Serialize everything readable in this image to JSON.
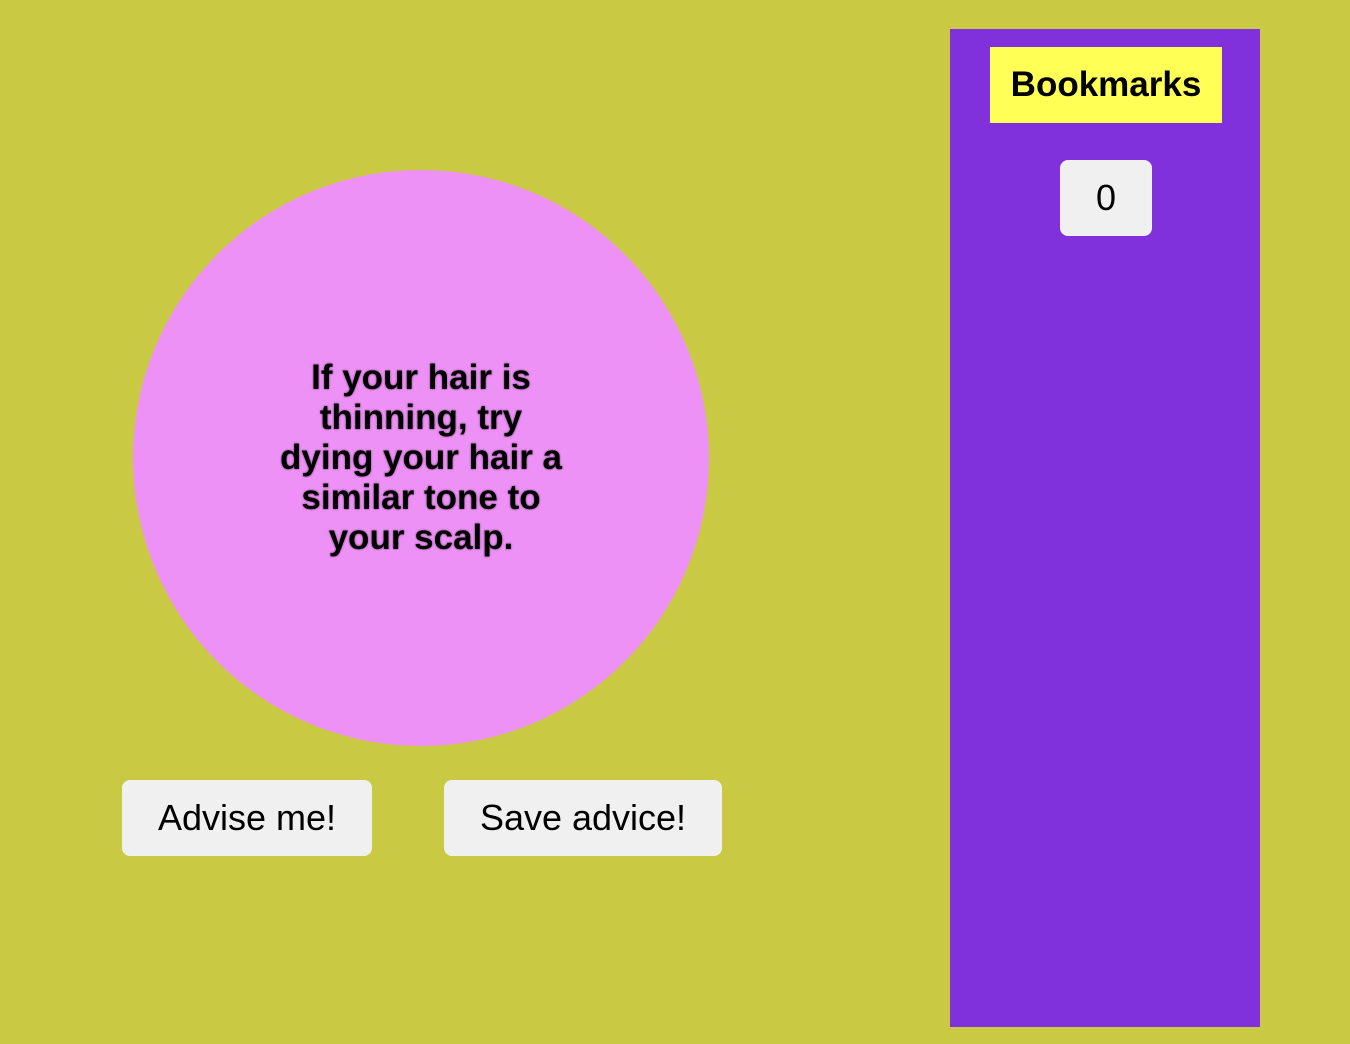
{
  "advice": {
    "text": "If your hair is thinning, try dying your hair a similar tone to your scalp."
  },
  "actions": {
    "advise_label": "Advise me!",
    "save_label": "Save advice!"
  },
  "bookmarks": {
    "title": "Bookmarks",
    "count": "0"
  },
  "colors": {
    "background": "#cac944",
    "circle": "#ee91f6",
    "panel": "#8031db",
    "title_bg": "#ffff55",
    "button_bg": "#f0f0f0"
  }
}
